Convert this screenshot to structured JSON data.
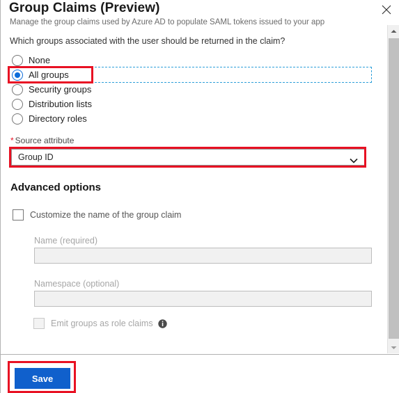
{
  "panel": {
    "title": "Group Claims (Preview)",
    "subtitle": "Manage the group claims used by Azure AD to populate SAML tokens issued to your app",
    "close_icon": "close-icon"
  },
  "question": "Which groups associated with the user should be returned in the claim?",
  "radio_group": {
    "name": "groups-returned",
    "selected": "All groups",
    "options": [
      {
        "label": "None",
        "checked": false
      },
      {
        "label": "All groups",
        "checked": true
      },
      {
        "label": "Security groups",
        "checked": false
      },
      {
        "label": "Distribution lists",
        "checked": false
      },
      {
        "label": "Directory roles",
        "checked": false
      }
    ]
  },
  "source_attribute": {
    "required_marker": "*",
    "label": "Source attribute",
    "value": "Group ID",
    "chevron_icon": "chevron-down-icon"
  },
  "advanced": {
    "heading": "Advanced options",
    "customize_checkbox": {
      "label": "Customize the name of the group claim",
      "checked": false,
      "disabled": false
    },
    "name_field": {
      "label": "Name (required)",
      "value": "",
      "disabled": true
    },
    "namespace_field": {
      "label": "Namespace (optional)",
      "value": "",
      "disabled": true
    },
    "emit_role_claims": {
      "label": "Emit groups as role claims",
      "checked": false,
      "disabled": true,
      "info_icon": "info-icon"
    }
  },
  "footer": {
    "save_label": "Save"
  },
  "scrollbar": {
    "up_icon": "scroll-up-arrow-icon",
    "down_icon": "scroll-down-arrow-icon"
  },
  "colors": {
    "accent_blue": "#1060cc",
    "radio_blue": "#0b6cda",
    "highlight_red": "#e81123",
    "focus_dash_blue": "#2c9fd9"
  }
}
